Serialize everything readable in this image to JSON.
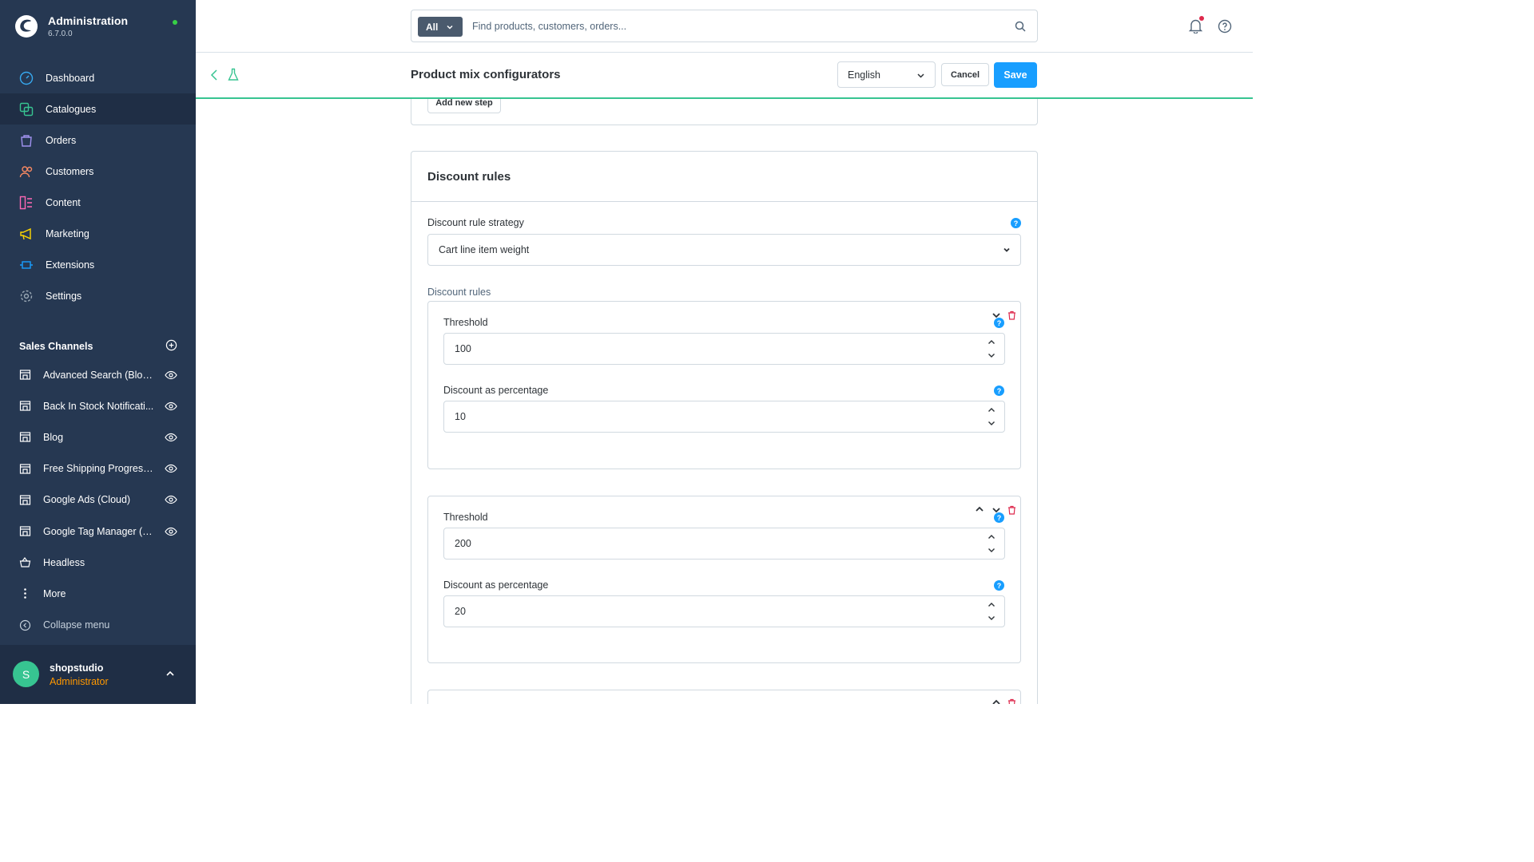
{
  "app": {
    "title": "Administration",
    "version": "6.7.0.0"
  },
  "nav": {
    "items": [
      {
        "label": "Dashboard",
        "icon": "dashboard-icon"
      },
      {
        "label": "Catalogues",
        "icon": "catalogue-icon"
      },
      {
        "label": "Orders",
        "icon": "orders-icon"
      },
      {
        "label": "Customers",
        "icon": "customers-icon"
      },
      {
        "label": "Content",
        "icon": "content-icon"
      },
      {
        "label": "Marketing",
        "icon": "marketing-icon"
      },
      {
        "label": "Extensions",
        "icon": "extensions-icon"
      },
      {
        "label": "Settings",
        "icon": "settings-icon"
      }
    ]
  },
  "sales_channels": {
    "title": "Sales Channels",
    "items": [
      {
        "label": "Advanced Search (Blog ..."
      },
      {
        "label": "Back In Stock Notificati..."
      },
      {
        "label": "Blog"
      },
      {
        "label": "Free Shipping Progress ..."
      },
      {
        "label": "Google Ads (Cloud)"
      },
      {
        "label": "Google Tag Manager (C..."
      },
      {
        "label": "Headless"
      },
      {
        "label": "More"
      },
      {
        "label": "Collapse menu"
      }
    ]
  },
  "user": {
    "initial": "S",
    "name": "shopstudio",
    "role": "Administrator"
  },
  "search": {
    "type": "All",
    "placeholder": "Find products, customers, orders..."
  },
  "smartbar": {
    "title": "Product mix configurators",
    "language": "English",
    "cancel_label": "Cancel",
    "save_label": "Save"
  },
  "steps_card": {
    "add_step_label": "Add new step"
  },
  "discount": {
    "title": "Discount rules",
    "strategy_label": "Discount rule strategy",
    "strategy_value": "Cart line item weight",
    "rules_label": "Discount rules",
    "rules": [
      {
        "threshold_label": "Threshold",
        "threshold": "100",
        "percentage_label": "Discount as percentage",
        "percentage": "10"
      },
      {
        "threshold_label": "Threshold",
        "threshold": "200",
        "percentage_label": "Discount as percentage",
        "percentage": "20"
      }
    ],
    "help_glyph": "?"
  },
  "colors": {
    "sidebar": "#263852",
    "accent": "#189eff",
    "success": "#37c491",
    "danger": "#de294c",
    "warning": "#ff9800"
  }
}
